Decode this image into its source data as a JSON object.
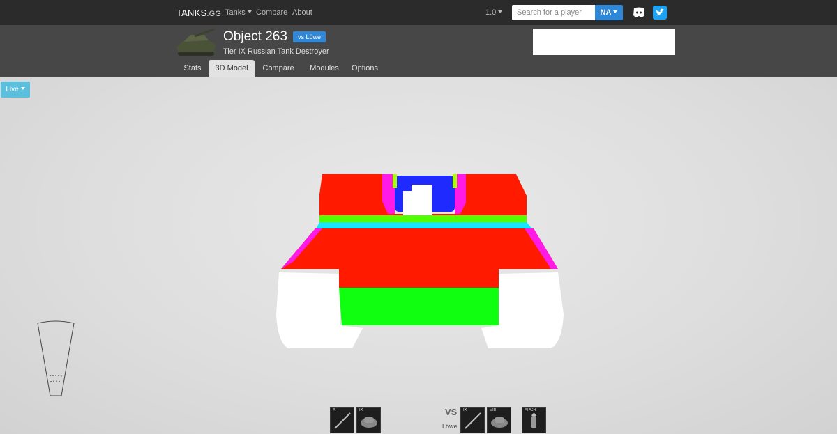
{
  "nav": {
    "brand": "TANKS",
    "brand_suffix": ".GG",
    "links": [
      "Tanks",
      "Compare",
      "About"
    ],
    "version": "1.0",
    "search_placeholder": "Search for a player",
    "region": "NA"
  },
  "tank": {
    "name": "Object 263",
    "vs_label": "vs Löwe",
    "subtitle": "Tier IX Russian Tank Destroyer"
  },
  "tabs": [
    "Stats",
    "3D Model",
    "Compare",
    "Modules",
    "Options"
  ],
  "active_tab": "3D Model",
  "viewer": {
    "mode_button": "Live"
  },
  "modules": {
    "left": [
      {
        "tier": "X"
      },
      {
        "tier": "IX"
      }
    ],
    "vs": "VS",
    "opponent": "Löwe",
    "right": [
      {
        "tier": "IX"
      },
      {
        "tier": "VIII"
      },
      {
        "tier": "APCR"
      }
    ]
  },
  "colors": {
    "nav_bg": "#2b2b2b",
    "header_bg": "#474747",
    "accent": "#2f87d8",
    "live": "#5bc0de"
  },
  "icons": [
    "dropdown-caret-icon",
    "discord-icon",
    "twitter-icon",
    "gun-module-icon",
    "turret-module-icon",
    "shell-module-icon"
  ]
}
